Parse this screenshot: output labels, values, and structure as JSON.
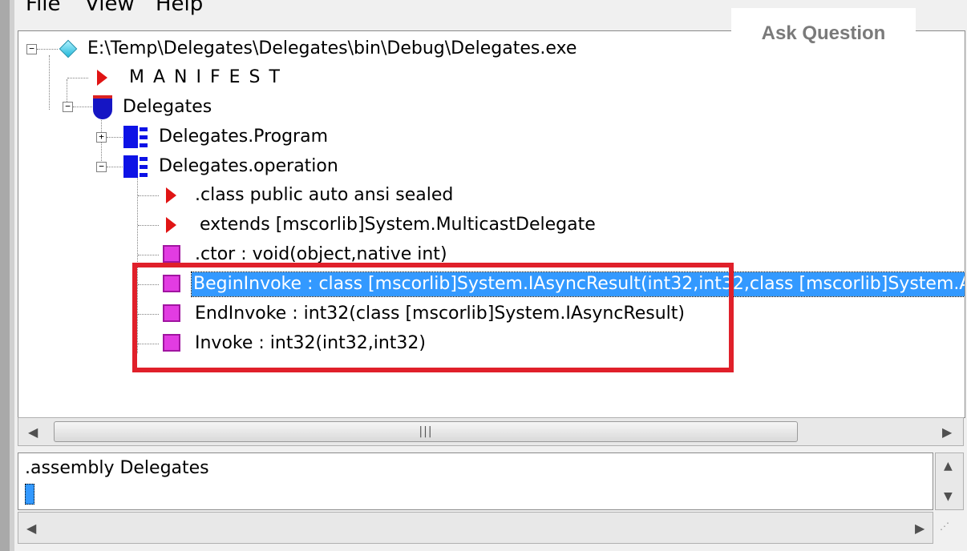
{
  "menubar": {
    "file": "File",
    "view": "View",
    "help": "Help"
  },
  "overlay": {
    "ask_question": "Ask Question"
  },
  "tree": {
    "root": "E:\\Temp\\Delegates\\Delegates\\bin\\Debug\\Delegates.exe",
    "manifest": "M A N I F E S T",
    "namespace": "Delegates",
    "program": "Delegates.Program",
    "operation": "Delegates.operation",
    "class_decl": ".class public auto ansi sealed",
    "extends": "extends [mscorlib]System.MulticastDelegate",
    "ctor": ".ctor : void(object,native int)",
    "begin_invoke": "BeginInvoke : class [mscorlib]System.IAsyncResult(int32,int32,class [mscorlib]System.A",
    "end_invoke": "EndInvoke : int32(class [mscorlib]System.IAsyncResult)",
    "invoke": "Invoke : int32(int32,int32)",
    "expand_plus": "+",
    "expand_minus": "−"
  },
  "scrollbar": {
    "left": "◀",
    "right": "▶",
    "grip": "|||",
    "up": "▲",
    "down": "▼"
  },
  "bottom_pane": {
    "line1": ".assembly Delegates",
    "resize_grip": "⋰"
  }
}
